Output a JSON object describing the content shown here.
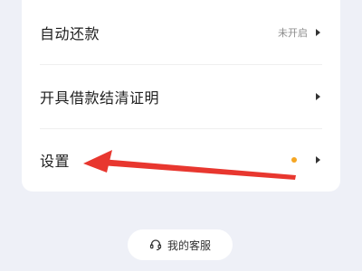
{
  "menu": {
    "items": [
      {
        "label": "自动还款",
        "value": "未开启",
        "icon": "chevron-right-icon"
      },
      {
        "label": "开具借款结清证明",
        "icon": "chevron-right-icon"
      },
      {
        "label": "设置",
        "indicator": "orange-dot",
        "icon": "chevron-right-icon"
      }
    ]
  },
  "service": {
    "label": "我的客服",
    "icon": "headset-icon"
  },
  "annotation": {
    "type": "red-arrow",
    "color": "#e8372f",
    "points_to": "设置"
  },
  "colors": {
    "background": "#eef0f7",
    "card": "#ffffff",
    "dot": "#f5a623",
    "arrow": "#e8372f"
  }
}
